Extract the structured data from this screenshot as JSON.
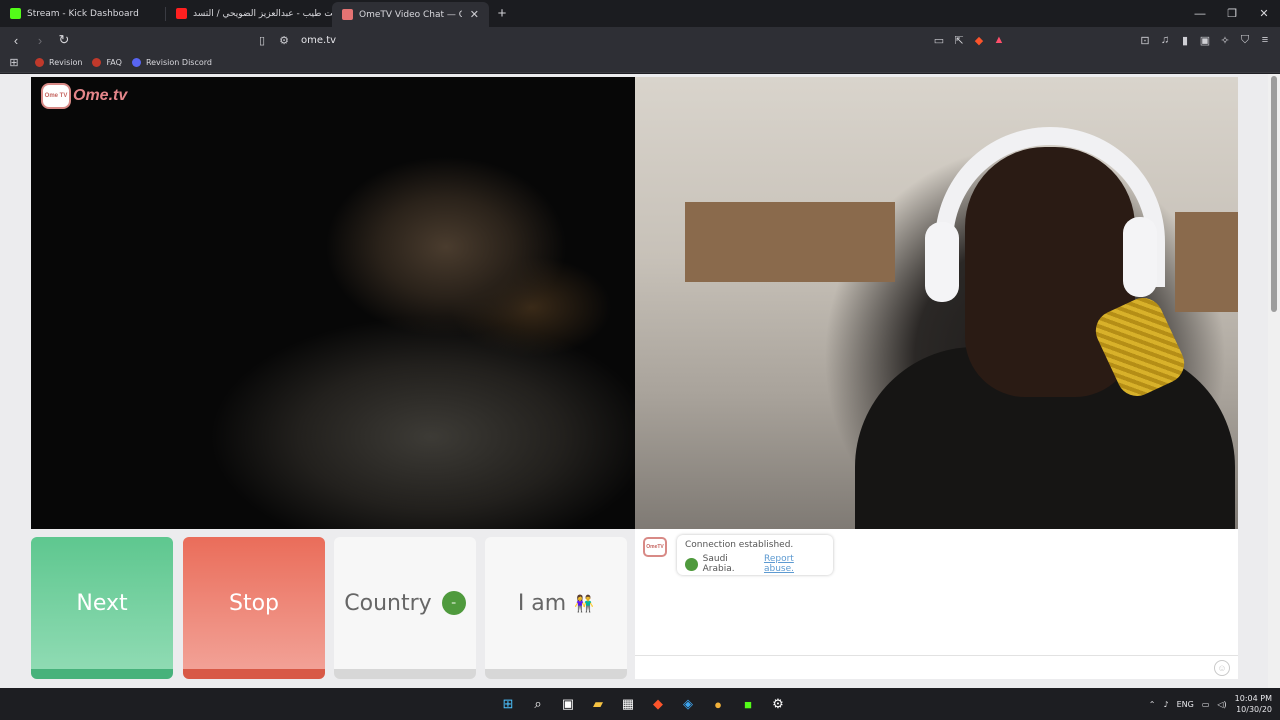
{
  "browser": {
    "tabs": [
      {
        "title": "Stream - Kick Dashboard",
        "favicon_color": "#53fc18",
        "active": false
      },
      {
        "title": "أنت طيب - عبدالعزيز الضويحي / التسد",
        "favicon_color": "#ff2020",
        "active": false
      },
      {
        "title": "OmeTV Video Chat — Omeg",
        "favicon_color": "#e57373",
        "active": true
      }
    ],
    "new_tab_icon": "plus-icon",
    "url": "ome.tv",
    "bookmarks": [
      {
        "label": "Revision",
        "color": "#c0392b"
      },
      {
        "label": "FAQ",
        "color": "#c0392b"
      },
      {
        "label": "Revision Discord",
        "color": "#5865f2"
      }
    ]
  },
  "ometv": {
    "logo_badge": "Ome TV",
    "logo_text": "Ome.tv",
    "buttons": {
      "next": "Next",
      "stop": "Stop",
      "country": "Country",
      "iam": "I am"
    },
    "chat": {
      "line1": "Connection established.",
      "country": "Saudi Arabia.",
      "report": "Report abuse."
    }
  },
  "colors": {
    "next": "#5ec78f",
    "stop": "#ea6d5a",
    "accent_logo": "#e4868a"
  },
  "taskbar": {
    "lang": "ENG",
    "time": "10:04 PM",
    "date": "10/30/20"
  }
}
